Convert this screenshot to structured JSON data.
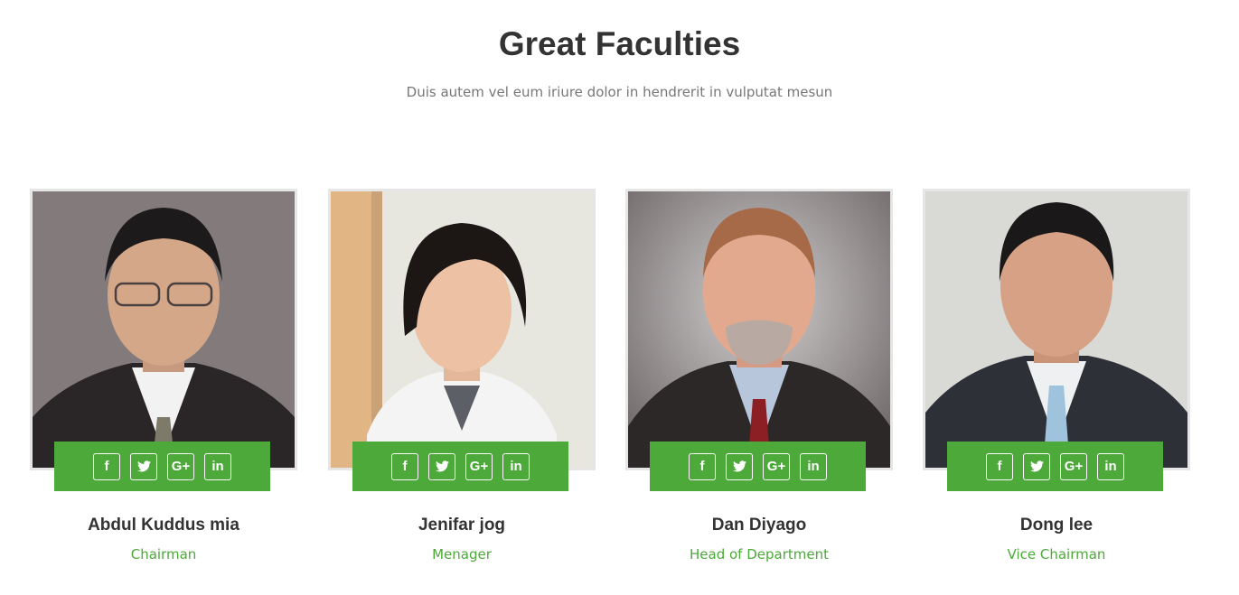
{
  "section": {
    "title": "Great Faculties",
    "subtitle": "Duis autem vel eum iriure dolor in hendrerit in vulputat mesun"
  },
  "colors": {
    "accent": "#4ca93a",
    "heading": "#333333",
    "muted": "#777777",
    "frame": "#e6e6e6"
  },
  "social_icons": [
    "facebook-icon",
    "twitter-icon",
    "google-plus-icon",
    "linkedin-icon"
  ],
  "social_glyphs": {
    "facebook": "f",
    "twitter": "🐦",
    "google_plus": "G+",
    "linkedin": "in"
  },
  "faculty": [
    {
      "name": "Abdul Kuddus mia",
      "role": "Chairman"
    },
    {
      "name": "Jenifar jog",
      "role": "Menager"
    },
    {
      "name": "Dan Diyago",
      "role": "Head of Department"
    },
    {
      "name": "Dong lee",
      "role": "Vice Chairman"
    }
  ]
}
